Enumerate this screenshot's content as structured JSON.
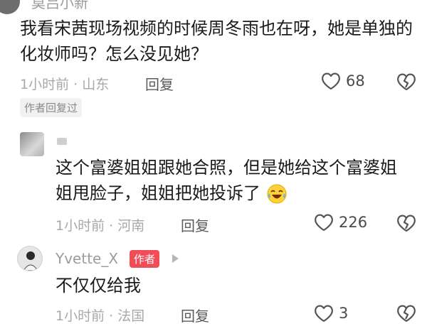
{
  "comment1": {
    "name": "莫吕小新",
    "text": "我看宋茜现场视频的时候周冬雨也在呀，她是单独的化妆师吗？怎么没见她？",
    "meta": "1小时前 · 山东",
    "reply": "回复",
    "likes": "68",
    "replied_badge": "作者回复过"
  },
  "comment2": {
    "text": "这个富婆姐姐跟她合照，但是她给这个富婆姐姐甩脸子，姐姐把她投诉了",
    "meta": "1小时前 · 河南",
    "reply": "回复",
    "likes": "226"
  },
  "comment3": {
    "name": "Yvette_X",
    "author_badge": "作者",
    "text": "不仅仅给我",
    "meta": "1小时前 · 法国",
    "reply": "回复",
    "likes": "3"
  },
  "icons": {
    "like": "heart-outline-icon",
    "dislike": "broken-heart-outline-icon",
    "laugh": "laughing-crying-emoji-icon",
    "play": "play-triangle-icon"
  },
  "colors": {
    "author_badge_bg": "#f04d58",
    "meta_text": "#a8a8a8"
  }
}
